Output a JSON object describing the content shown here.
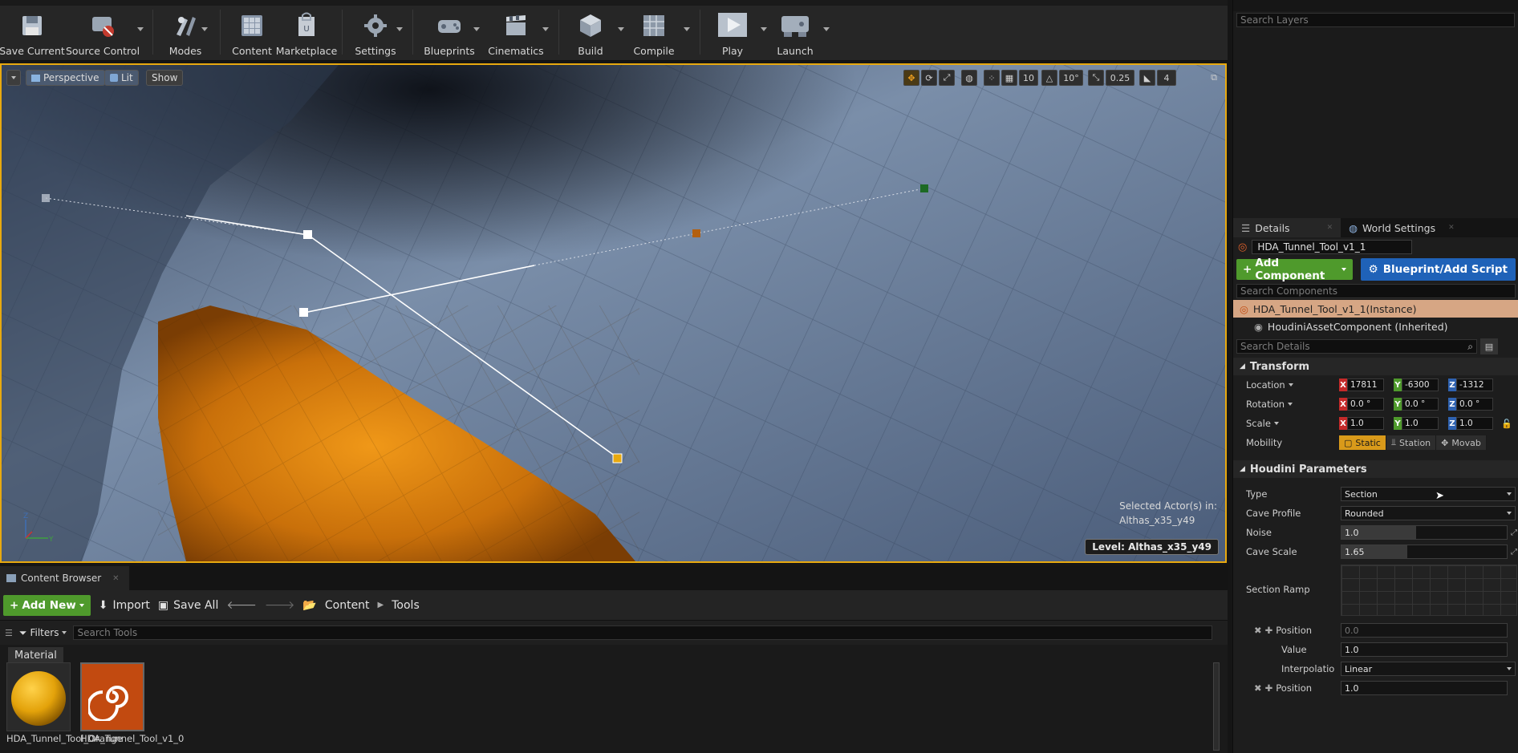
{
  "toolbar": {
    "buttons": [
      {
        "label": "Save Current",
        "icon": "save-icon"
      },
      {
        "label": "Source Control",
        "icon": "source-control-icon"
      },
      {
        "label": "Modes",
        "icon": "modes-icon"
      },
      {
        "label": "Content",
        "icon": "content-icon"
      },
      {
        "label": "Marketplace",
        "icon": "marketplace-icon"
      },
      {
        "label": "Settings",
        "icon": "settings-icon"
      },
      {
        "label": "Blueprints",
        "icon": "blueprints-icon"
      },
      {
        "label": "Cinematics",
        "icon": "cinematics-icon"
      },
      {
        "label": "Build",
        "icon": "build-icon"
      },
      {
        "label": "Compile",
        "icon": "compile-icon"
      },
      {
        "label": "Play",
        "icon": "play-icon"
      },
      {
        "label": "Launch",
        "icon": "launch-icon"
      }
    ]
  },
  "viewport": {
    "view_mode": "Perspective",
    "lighting": "Lit",
    "show": "Show",
    "grid_snap": "10",
    "rotation_snap": "10°",
    "scale_snap": "0.25",
    "camera_speed": "4",
    "selected_actors_label": "Selected Actor(s) in:",
    "selected_actors_level": "Althas_x35_y49",
    "level_label": "Level:  Althas_x35_y49",
    "colors": {
      "selection_border": "#e8a90f",
      "rock": "#e08a10",
      "cave": "#5a6e8c"
    }
  },
  "content_browser": {
    "tab_label": "Content Browser",
    "add_new": "Add New",
    "import": "Import",
    "save_all": "Save All",
    "path": [
      "Content",
      "Tools"
    ],
    "filters": "Filters",
    "search_placeholder": "Search Tools",
    "category": "Material",
    "assets": [
      {
        "name": "HDA_Tunnel_Tool_Orange"
      },
      {
        "name": "HDA_Tunnel_Tool_v1_0"
      }
    ]
  },
  "layers": {
    "search_placeholder": "Search Layers"
  },
  "details": {
    "tab_details": "Details",
    "tab_world_settings": "World Settings",
    "actor_name": "HDA_Tunnel_Tool_v1_1",
    "add_component": "Add Component",
    "blueprint_script": "Blueprint/Add Script",
    "search_components_placeholder": "Search Components",
    "components": [
      {
        "label": "HDA_Tunnel_Tool_v1_1(Instance)"
      },
      {
        "label": "HoudiniAssetComponent (Inherited)"
      }
    ],
    "search_details_placeholder": "Search Details",
    "transform": {
      "header": "Transform",
      "location_label": "Location",
      "location": {
        "x": "17811",
        "y": "-6300",
        "z": "-1312"
      },
      "rotation_label": "Rotation",
      "rotation": {
        "x": "0.0 °",
        "y": "0.0 °",
        "z": "0.0 °"
      },
      "scale_label": "Scale",
      "scale": {
        "x": "1.0",
        "y": "1.0",
        "z": "1.0"
      },
      "mobility_label": "Mobility",
      "mobility_options": [
        "Static",
        "Station",
        "Movab"
      ],
      "mobility_selected": "Static"
    },
    "houdini": {
      "header": "Houdini Parameters",
      "type_label": "Type",
      "type_value": "Section",
      "cave_profile_label": "Cave Profile",
      "cave_profile_value": "Rounded",
      "noise_label": "Noise",
      "noise_value": "1.0",
      "noise_fill": 0.45,
      "cave_scale_label": "Cave Scale",
      "cave_scale_value": "1.65",
      "cave_scale_fill": 0.4,
      "section_ramp_label": "Section Ramp",
      "ramp_points": [
        {
          "position_label": "Position",
          "position": "0.0",
          "value_label": "Value",
          "value": "1.0",
          "interp_label": "Interpolatio",
          "interp": "Linear"
        },
        {
          "position_label": "Position",
          "position": "1.0"
        }
      ]
    }
  }
}
